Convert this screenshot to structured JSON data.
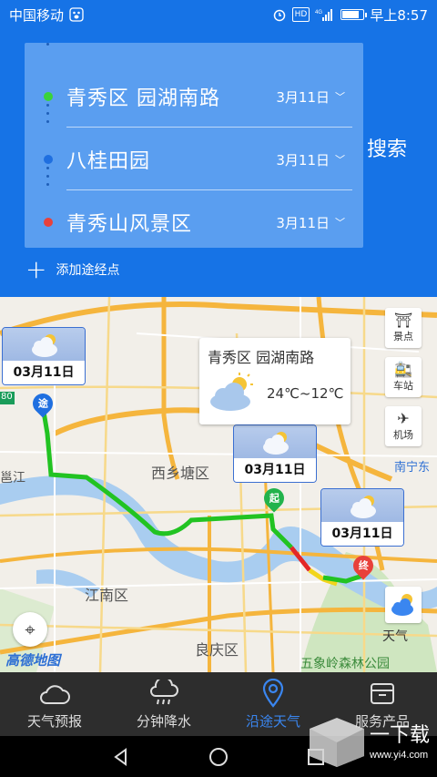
{
  "status_bar": {
    "carrier": "中国移动",
    "network": "4G",
    "hd": "HD",
    "time": "早上8:57",
    "battery_level": 0.85
  },
  "route": {
    "stops": [
      {
        "name": "青秀区 园湖南路",
        "date": "3月11日",
        "dot_color": "#3ad33a"
      },
      {
        "name": "八桂田园",
        "date": "3月11日",
        "dot_color": "#1f6fe0"
      },
      {
        "name": "青秀山风景区",
        "date": "3月11日",
        "dot_color": "#e8413b"
      }
    ],
    "search_label": "搜索",
    "add_waypoint_label": "添加途经点"
  },
  "map": {
    "labels": {
      "xixiangtang": "西乡塘区",
      "jiangnan": "江南区",
      "liangqing": "良庆区",
      "wuxiangling": "五象岭森林公园",
      "nanning_east": "南宁东",
      "yongjiang": "邕江",
      "road_80": "80"
    },
    "weather_cards": [
      {
        "date": "03月11日"
      },
      {
        "date": "03月11日"
      },
      {
        "date": "03月11日"
      }
    ],
    "popup": {
      "title": "青秀区 园湖南路",
      "temperature": "24℃~12℃"
    },
    "markers": {
      "via": "途",
      "start": "起",
      "end": "终"
    },
    "side_buttons": {
      "scenic": "景点",
      "station": "车站",
      "airport": "机场"
    },
    "weather_label": "天气",
    "logo": "高德地图"
  },
  "tabs": [
    {
      "label": "天气预报",
      "icon": "cloud-icon"
    },
    {
      "label": "分钟降水",
      "icon": "rain-cloud-icon"
    },
    {
      "label": "沿途天气",
      "icon": "location-pin-icon",
      "active": true
    },
    {
      "label": "服务产品",
      "icon": "box-icon"
    }
  ],
  "watermark": {
    "text": "一下载",
    "url": "www.yi4.com"
  },
  "colors": {
    "header_blue": "#1673e6",
    "route_panel": "#5a9ef0",
    "route_green": "#22c322",
    "route_red": "#e32727",
    "route_yellow": "#f2d51b",
    "active_tab": "#3a86f0"
  }
}
